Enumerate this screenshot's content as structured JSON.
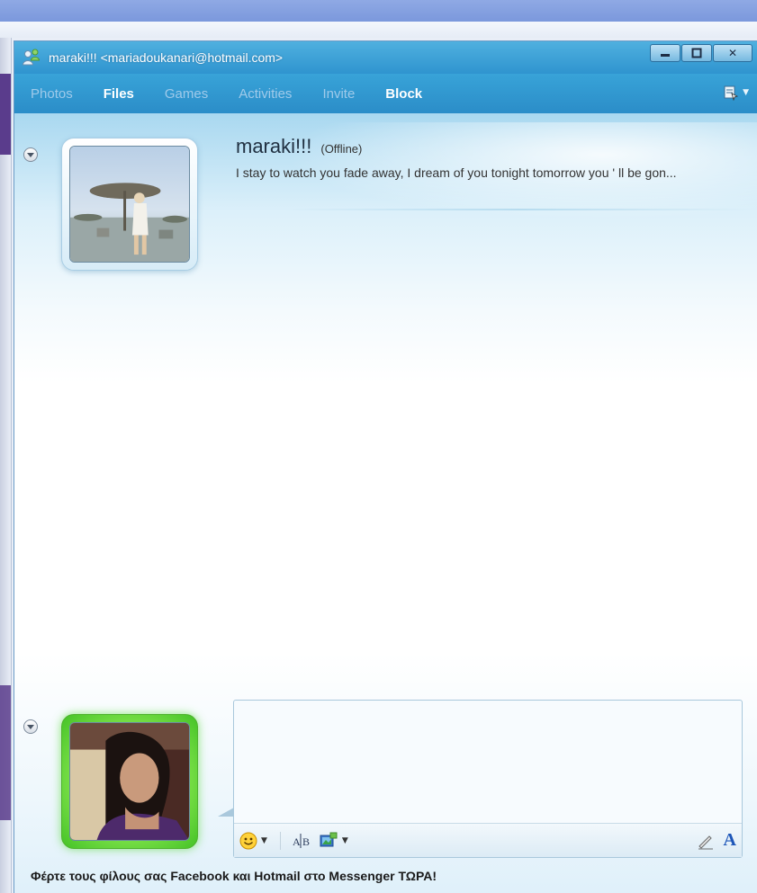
{
  "window": {
    "title": "maraki!!! <mariadoukanari@hotmail.com>"
  },
  "menu": {
    "items": [
      {
        "label": "Photos",
        "active": false
      },
      {
        "label": "Files",
        "active": true
      },
      {
        "label": "Games",
        "active": false
      },
      {
        "label": "Activities",
        "active": false
      },
      {
        "label": "Invite",
        "active": false
      },
      {
        "label": "Block",
        "active": true
      }
    ]
  },
  "contact": {
    "name": "maraki!!!",
    "status": "(Offline)",
    "personal_message": "I stay to watch you fade away, I dream of you tonight tomorrow you ' ll be gon..."
  },
  "compose": {
    "value": ""
  },
  "promo": {
    "text": "Φέρτε τους φίλους σας Facebook και Hotmail στο Messenger ΤΩΡΑ!"
  },
  "icons": {
    "app": "messenger-icon",
    "menu_right": "options-menu-icon",
    "emoticon": "smiley-icon",
    "spellcheck": "spellcheck-icon",
    "media": "send-media-icon",
    "handwriting": "pen-icon",
    "font": "font-icon"
  },
  "colors": {
    "titlebar": "#3aa6da",
    "menubar": "#2b8dc8",
    "self_frame": "#6fdc3f"
  }
}
